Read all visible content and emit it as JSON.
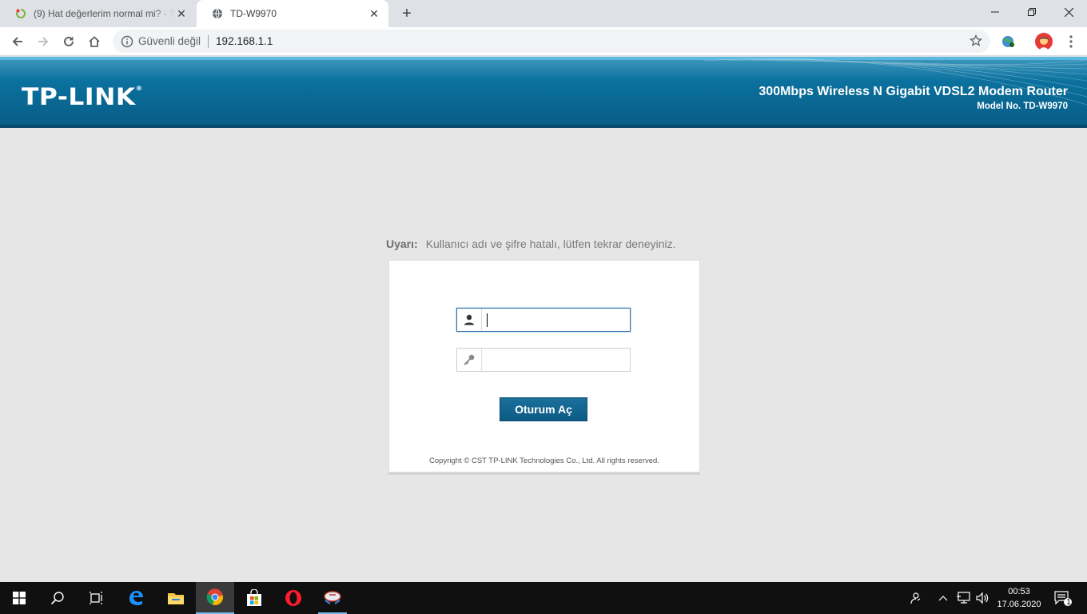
{
  "browser": {
    "tabs": [
      {
        "title": "(9) Hat değerlerim normal mi? - T",
        "active": false
      },
      {
        "title": "TD-W9970",
        "active": true
      }
    ],
    "security_label": "Güvenli değil",
    "url": "192.168.1.1"
  },
  "router": {
    "logo": "TP-LINK",
    "logo_mark": "®",
    "product_name": "300Mbps Wireless N Gigabit VDSL2 Modem Router",
    "model": "Model No. TD-W9970",
    "warning_label": "Uyarı:",
    "warning_text": "Kullanıcı adı ve şifre hatalı, lütfen tekrar deneyiniz.",
    "username": {
      "value": ""
    },
    "password": {
      "value": ""
    },
    "login_button": "Oturum Aç",
    "copyright": "Copyright © CST TP-LINK Technologies Co., Ltd. All rights reserved."
  },
  "taskbar": {
    "time": "00:53",
    "date": "17.06.2020",
    "notification_count": "1"
  },
  "colors": {
    "header_blue": "#0b6f9c",
    "button_blue": "#0c5b84",
    "taskbar": "#101010"
  }
}
